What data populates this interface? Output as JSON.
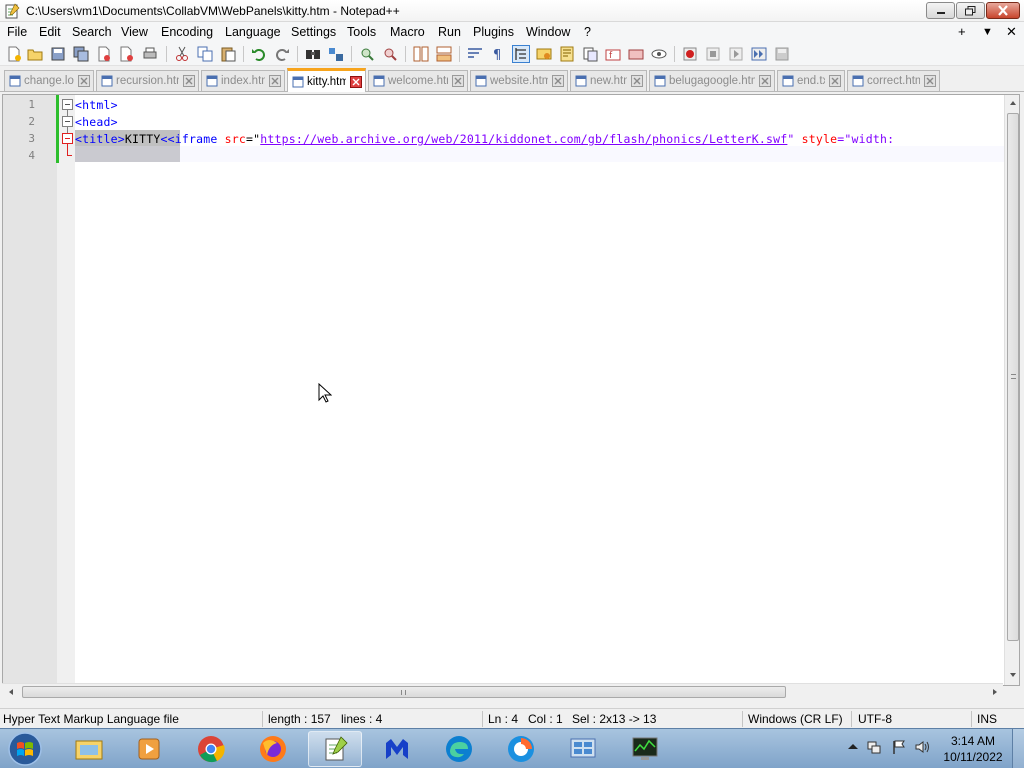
{
  "window": {
    "title": "C:\\Users\\vm1\\Documents\\CollabVM\\WebPanels\\kitty.htm - Notepad++"
  },
  "menu": {
    "items": [
      "File",
      "Edit",
      "Search",
      "View",
      "Encoding",
      "Language",
      "Settings",
      "Tools",
      "Macro",
      "Run",
      "Plugins",
      "Window",
      "?"
    ],
    "right": [
      "+",
      "▼",
      "✕"
    ]
  },
  "toolbar": {
    "icons": [
      "new-file-icon",
      "open-file-icon",
      "save-icon",
      "save-all-icon",
      "close-icon",
      "close-all-icon",
      "print-icon",
      "cut-icon",
      "copy-icon",
      "paste-icon",
      "undo-icon",
      "redo-icon",
      "find-icon",
      "replace-icon",
      "zoom-in-icon",
      "zoom-out-icon",
      "sync-v-icon",
      "sync-h-icon",
      "word-wrap-icon",
      "show-all-chars-icon",
      "indent-guide-icon",
      "udl-icon",
      "doc-map-icon",
      "function-list-icon",
      "folder-workspace-icon",
      "doc-switcher-icon",
      "monitor-icon",
      "record-macro-icon",
      "stop-macro-icon",
      "play-macro-icon",
      "run-macro-multiple-icon",
      "save-macro-icon"
    ]
  },
  "tabs": [
    {
      "label": "change.log",
      "active": false
    },
    {
      "label": "recursion.html",
      "active": false
    },
    {
      "label": "index.html",
      "active": false
    },
    {
      "label": "kitty.htm",
      "active": true
    },
    {
      "label": "welcome.html",
      "active": false
    },
    {
      "label": "website.html",
      "active": false
    },
    {
      "label": "new.htm",
      "active": false
    },
    {
      "label": "belugagoogle.html",
      "active": false
    },
    {
      "label": "end.txt",
      "active": false
    },
    {
      "label": "correct.html",
      "active": false
    }
  ],
  "editor": {
    "line_numbers": [
      "1",
      "2",
      "3",
      "4"
    ],
    "line1": "<html>",
    "line2": "<head>",
    "line3": {
      "title_tag": "<title>",
      "title_text": "KITTY",
      "lt": "<",
      "iframe_open": "<iframe",
      "src_attr": " src",
      "eq1": "=\"",
      "url": "https://web.archive.org/web/2011/kiddonet.com/gb/flash/phonics/LetterK.swf",
      "close_quote": "\"",
      "style_attr": " style",
      "eq2": "=\"width:"
    }
  },
  "status": {
    "file_type": "Hyper Text Markup Language file",
    "length": "length : 157",
    "lines": "lines : 4",
    "ln": "Ln : 4",
    "col": "Col : 1",
    "sel": "Sel : 2x13 -> 13",
    "eol": "Windows (CR LF)",
    "encoding": "UTF-8",
    "mode": "INS"
  },
  "taskbar": {
    "time": "3:14 AM",
    "date": "10/11/2022"
  },
  "colors": {
    "accent_tab": "#f7a41d",
    "tag": "#0000ff",
    "attr": "#ff0000",
    "string": "#8000ff",
    "change_bar": "#2cbe2c"
  }
}
